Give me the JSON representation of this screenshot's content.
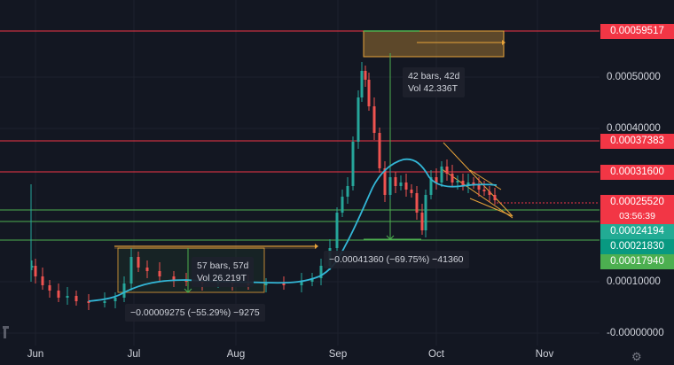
{
  "price_axis": {
    "ticks": [
      "0.00050000",
      "0.00040000",
      "0.00010000",
      "-0.00000000"
    ],
    "tags": [
      {
        "label": "0.00059517",
        "bg": "#f23645",
        "price": 0.00059517
      },
      {
        "label": "0.00037383",
        "bg": "#f23645",
        "price": 0.00037383
      },
      {
        "label": "0.00031600",
        "bg": "#f23645",
        "price": 0.000316
      },
      {
        "label": "0.00025520",
        "bg": "#f23645",
        "price": 0.0002552
      },
      {
        "label": "03:56:39",
        "bg": "#f23645",
        "price": 0.0002552
      },
      {
        "label": "0.00024194",
        "bg": "#22ab94",
        "price": 0.00024194
      },
      {
        "label": "0.00021830",
        "bg": "#089981",
        "price": 0.0002183
      },
      {
        "label": "0.00017940",
        "bg": "#4caf50",
        "price": 0.0001794
      }
    ]
  },
  "time_axis": [
    "Jun",
    "Jul",
    "Aug",
    "Sep",
    "Oct",
    "Nov"
  ],
  "measurements": {
    "jul_bars": "57 bars, 57d",
    "jul_vol": "Vol 26.219T",
    "jul_change": "−0.00009275 (−55.29%) −9275",
    "sep_change": "−0.00041360 (−69.75%) −41360",
    "top_bars": "42 bars, 42d",
    "top_vol": "Vol 42.336T"
  },
  "colors": {
    "background": "#131722",
    "up": "#26a69a",
    "down": "#ef5350",
    "ma": "#33b6d6",
    "resistance": "#f23645",
    "support": "#4caf50",
    "drawing": "#e8a33a",
    "measure": "#4caf50"
  },
  "icons": {
    "settings": "gear-icon",
    "logo": "tradingview-logo"
  },
  "chart_data": {
    "type": "candlestick",
    "x": [
      "Jun",
      "Jul",
      "Aug",
      "Sep",
      "Oct",
      "Nov"
    ],
    "ylim": [
      -1e-05,
      0.0006
    ],
    "horizontal_levels": [
      0.00059517,
      0.00037383,
      0.000316,
      0.00024194,
      0.0002183,
      0.0001794
    ],
    "ma_series": [
      [
        8e-05,
        "Jun 25"
      ],
      [
        9e-05,
        "Jul 10"
      ],
      [
        0.00011,
        "Jul 25"
      ],
      [
        0.000105,
        "Aug 20"
      ],
      [
        0.00011,
        "Aug 30"
      ],
      [
        0.00015,
        "Sep 5"
      ],
      [
        0.00024,
        "Sep 12"
      ],
      [
        0.0003,
        "Sep 20"
      ],
      [
        0.00032,
        "Sep 26"
      ],
      [
        0.00029,
        "Oct 5"
      ],
      [
        0.00028,
        "Oct 15"
      ],
      [
        0.00027,
        "Oct 22"
      ]
    ]
  }
}
